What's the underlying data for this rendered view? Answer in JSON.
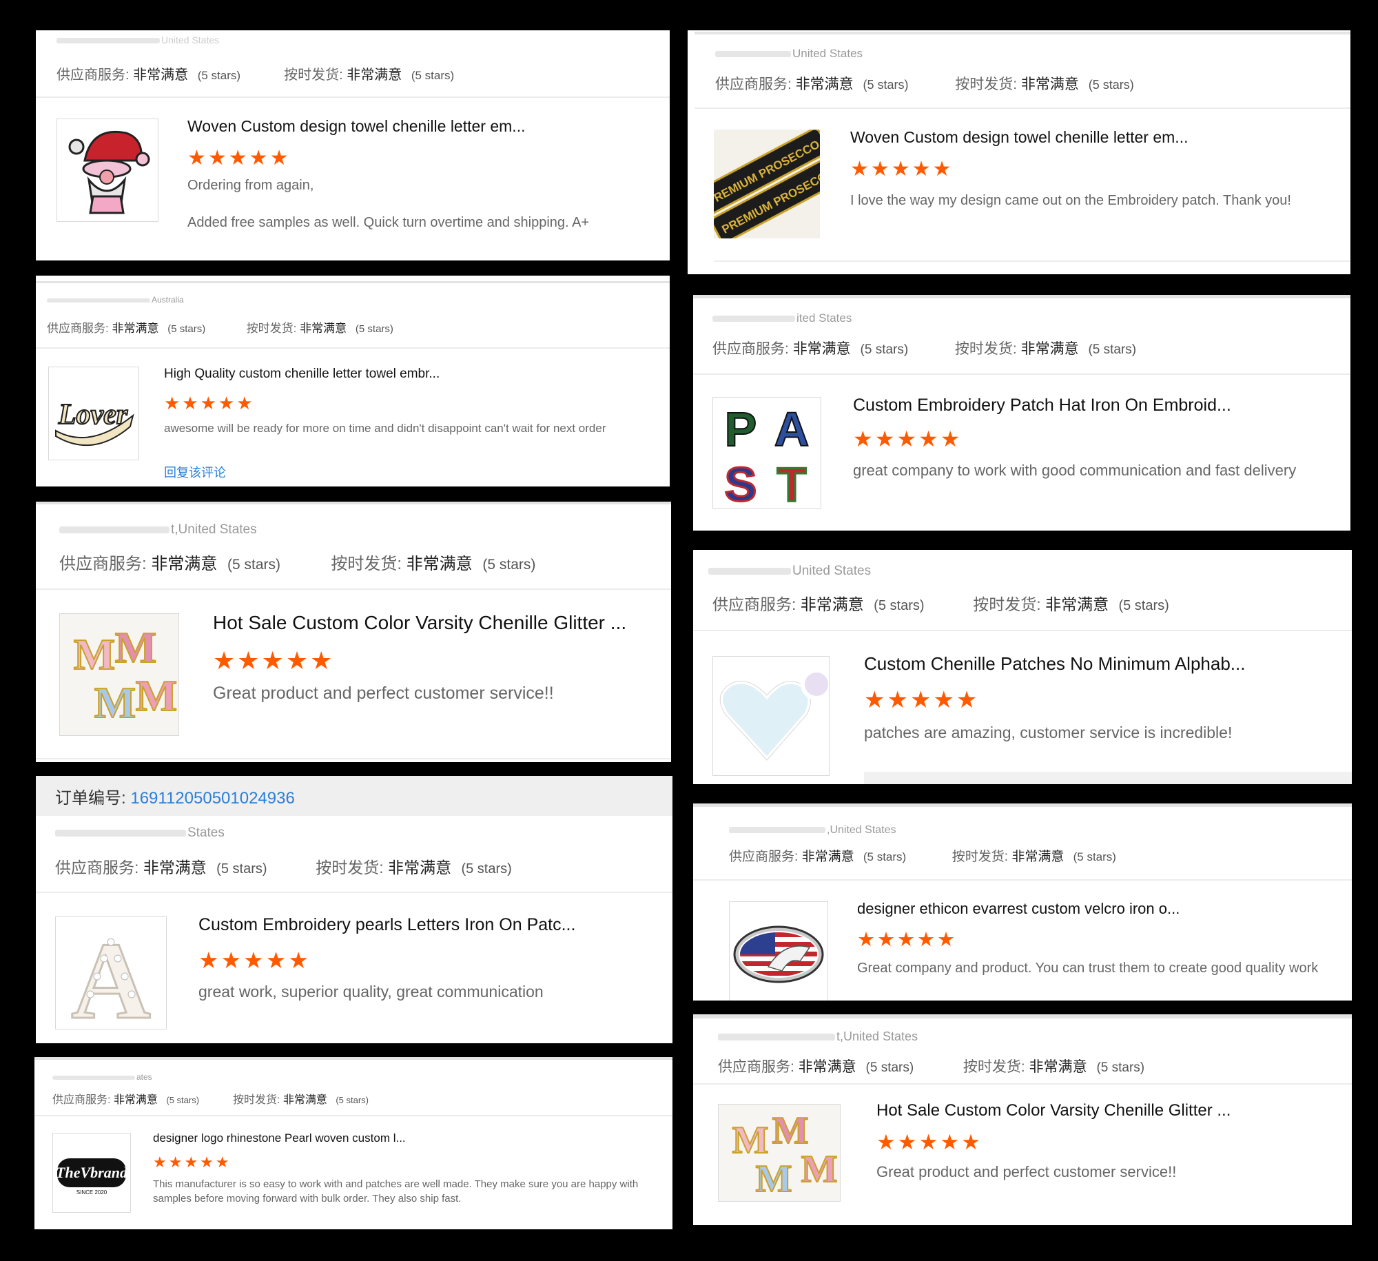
{
  "reviews": [
    {
      "user": "United States",
      "svc_label": "供应商服务:",
      "svc_value": "非常满意",
      "svc_stars": "(5 stars)",
      "ship_label": "按时发货:",
      "ship_value": "非常满意",
      "ship_stars": "(5 stars)",
      "title": "Woven Custom design towel chenille letter em...",
      "stars": "★★★★★",
      "review": "Ordering from again,",
      "review2": "Added free samples as well. Quick turn overtime and shipping. A+",
      "thumb_icon": "gnome-patch-icon"
    },
    {
      "user": "United States",
      "svc_label": "供应商服务:",
      "svc_value": "非常满意",
      "svc_stars": "(5 stars)",
      "ship_label": "按时发货:",
      "ship_value": "非常满意",
      "ship_stars": "(5 stars)",
      "title": "Woven Custom design towel chenille letter em...",
      "stars": "★★★★★",
      "review": "I love the way my design came out on the Embroidery patch. Thank you!",
      "thumb_icon": "premium-prosecco-patch-icon",
      "thumb_text": "PREMIUM PROSECCO"
    },
    {
      "user": "Australia",
      "svc_label": "供应商服务:",
      "svc_value": "非常满意",
      "svc_stars": "(5 stars)",
      "ship_label": "按时发货:",
      "ship_value": "非常满意",
      "ship_stars": "(5 stars)",
      "title": "High Quality custom chenille letter towel embr...",
      "stars": "★★★★★",
      "review": "awesome will be ready for more on time and didn't disappoint can't wait for next order",
      "reply": "回复该评论",
      "thumb_icon": "lover-script-patch-icon",
      "thumb_text": "Lover"
    },
    {
      "user": "ited States",
      "svc_label": "供应商服务:",
      "svc_value": "非常满意",
      "svc_stars": "(5 stars)",
      "ship_label": "按时发货:",
      "ship_value": "非常满意",
      "ship_stars": "(5 stars)",
      "title": "Custom Embroidery Patch Hat Iron On Embroid...",
      "stars": "★★★★★",
      "review": "great company to work with good communication and fast delivery",
      "thumb_icon": "past-letters-patch-icon",
      "thumb_letters": [
        "P",
        "A",
        "S",
        "T"
      ]
    },
    {
      "user": "t,United States",
      "svc_label": "供应商服务:",
      "svc_value": "非常满意",
      "svc_stars": "(5 stars)",
      "ship_label": "按时发货:",
      "ship_value": "非常满意",
      "ship_stars": "(5 stars)",
      "title": "Hot Sale Custom Color Varsity Chenille Glitter ...",
      "stars": "★★★★★",
      "review": "Great product and perfect customer service!!",
      "thumb_icon": "mm-chenille-letters-icon",
      "thumb_letters": [
        "M",
        "M",
        "M",
        "M"
      ]
    },
    {
      "user": "United States",
      "svc_label": "供应商服务:",
      "svc_value": "非常满意",
      "svc_stars": "(5 stars)",
      "ship_label": "按时发货:",
      "ship_value": "非常满意",
      "ship_stars": "(5 stars)",
      "title": "Custom Chenille Patches No Minimum Alphab...",
      "stars": "★★★★★",
      "review": "patches are amazing, customer service is incredible!",
      "thumb_icon": "heart-patch-icon"
    },
    {
      "order_label": "订单编号:",
      "order_no": "169112050501024936",
      "user": "States",
      "svc_label": "供应商服务:",
      "svc_value": "非常满意",
      "svc_stars": "(5 stars)",
      "ship_label": "按时发货:",
      "ship_value": "非常满意",
      "ship_stars": "(5 stars)",
      "title": "Custom Embroidery pearls Letters Iron On Patc...",
      "stars": "★★★★★",
      "review": "great work, superior quality, great communication",
      "thumb_icon": "pearl-letter-a-icon",
      "thumb_text": "A"
    },
    {
      "user": ",United States",
      "svc_label": "供应商服务:",
      "svc_value": "非常满意",
      "svc_stars": "(5 stars)",
      "ship_label": "按时发货:",
      "ship_value": "非常满意",
      "ship_stars": "(5 stars)",
      "title": "designer ethicon evarrest custom velcro iron o...",
      "stars": "★★★★★",
      "review": "Great company and product. You can trust them to create good quality work",
      "thumb_icon": "flag-mustang-patch-icon"
    },
    {
      "user": "ates",
      "svc_label": "供应商服务:",
      "svc_value": "非常满意",
      "svc_stars": "(5 stars)",
      "ship_label": "按时发货:",
      "ship_value": "非常满意",
      "ship_stars": "(5 stars)",
      "title": "designer logo rhinestone Pearl woven custom l...",
      "stars": "★★★★★",
      "review": "This manufacturer is so easy to work with and patches are well made.  They make sure you are happy with samples before moving forward with bulk order. They also ship fast.",
      "thumb_icon": "the-vbrand-logo-icon",
      "thumb_text": "TheVbrand",
      "thumb_sub": "SINCE 2020"
    },
    {
      "user": "t,United States",
      "svc_label": "供应商服务:",
      "svc_value": "非常满意",
      "svc_stars": "(5 stars)",
      "ship_label": "按时发货:",
      "ship_value": "非常满意",
      "ship_stars": "(5 stars)",
      "title": "Hot Sale Custom Color Varsity Chenille Glitter ...",
      "stars": "★★★★★",
      "review": "Great product and perfect customer service!!",
      "thumb_icon": "mm-chenille-letters-icon",
      "thumb_letters": [
        "M",
        "M",
        "M",
        "M"
      ]
    }
  ],
  "colors": {
    "star": "#ff5a00",
    "link": "#2b7fd6",
    "background": "#000000"
  }
}
